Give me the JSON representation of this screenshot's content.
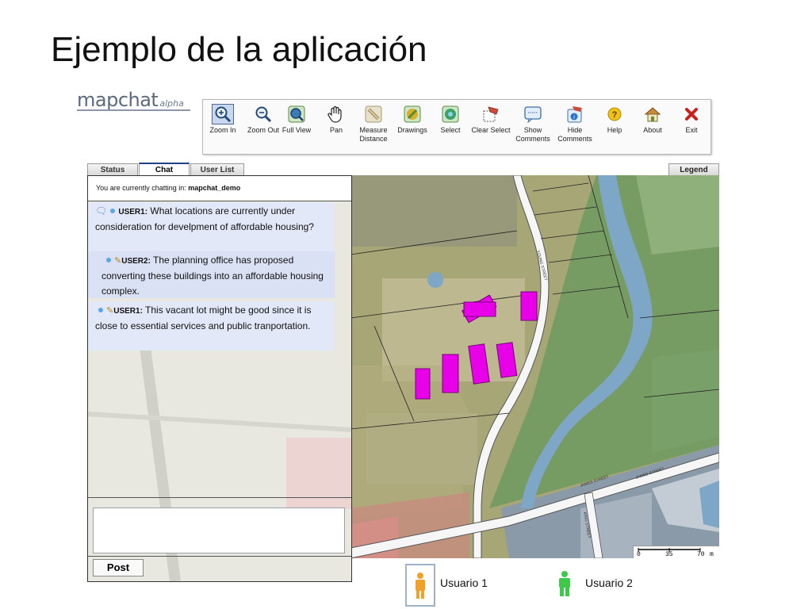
{
  "slide": {
    "title": "Ejemplo de la aplicación"
  },
  "logo": {
    "main": "mapchat",
    "sub": "alpha"
  },
  "toolbar": {
    "tools": [
      {
        "id": "zoom-in",
        "label": "Zoom In",
        "icon": "zoom-in-icon",
        "active": true
      },
      {
        "id": "zoom-out",
        "label": "Zoom Out",
        "icon": "zoom-out-icon"
      },
      {
        "id": "full-view",
        "label": "Full View",
        "icon": "full-view-icon"
      },
      {
        "id": "pan",
        "label": "Pan",
        "icon": "hand-icon"
      },
      {
        "id": "measure",
        "label": "Measure Distance",
        "icon": "ruler-icon"
      },
      {
        "id": "drawings",
        "label": "Drawings",
        "icon": "pencil-icon"
      },
      {
        "id": "select",
        "label": "Select",
        "icon": "select-icon"
      },
      {
        "id": "clear-select",
        "label": "Clear Select",
        "icon": "clear-select-icon"
      },
      {
        "id": "show-comments",
        "label": "Show Comments",
        "icon": "comment-icon"
      },
      {
        "id": "hide-comments",
        "label": "Hide Comments",
        "icon": "hide-comments-icon"
      },
      {
        "id": "help",
        "label": "Help",
        "icon": "help-icon"
      },
      {
        "id": "about",
        "label": "About",
        "icon": "home-icon"
      },
      {
        "id": "exit",
        "label": "Exit",
        "icon": "exit-icon"
      }
    ]
  },
  "tabs": {
    "status": "Status",
    "chat": "Chat",
    "user_list": "User List",
    "legend": "Legend"
  },
  "chat": {
    "header_prefix": "You are currently chatting in: ",
    "room": "mapchat_demo",
    "messages": [
      {
        "user": "USER1:",
        "text": "What locations are currently under consideration for develpment of affordable housing?"
      },
      {
        "user": "USER2:",
        "text": "The planning office has proposed converting these buildings into an affordable housing complex."
      },
      {
        "user": "USER1:",
        "text": "This vacant lot might be good since it is close to essential services and public tranportation."
      }
    ],
    "composer_value": "",
    "post_label": "Post"
  },
  "map": {
    "street_labels": [
      "YOUNG STREET",
      "JAMES STREET",
      "JAMES STREET",
      "KING STREET"
    ],
    "scale": {
      "ticks": [
        "0",
        "35",
        "70"
      ],
      "unit": "m"
    },
    "colors": {
      "selection": "#e800e8",
      "water": "#7ea7c7",
      "green_zone": "#6f9a60",
      "road": "#f6f6f6"
    }
  },
  "legend": [
    {
      "label": "Usuario 1",
      "icon": "person-orange-icon",
      "color": "#f0a12a"
    },
    {
      "label": "Usuario 2",
      "icon": "person-green-icon",
      "color": "#3ec94a"
    }
  ]
}
